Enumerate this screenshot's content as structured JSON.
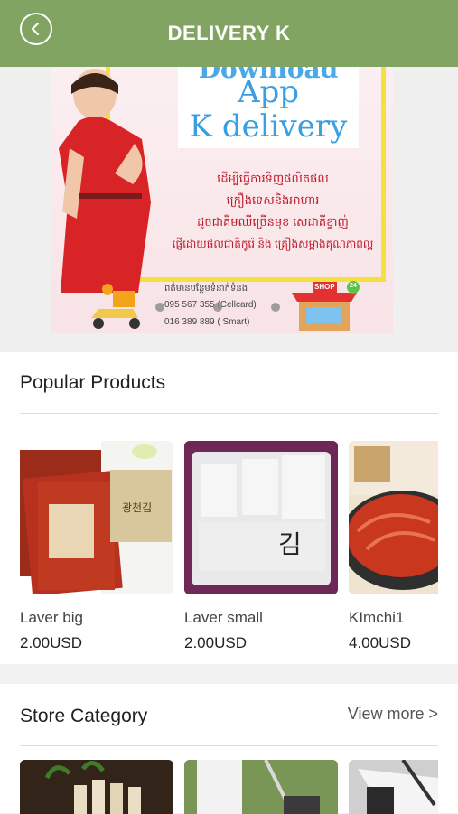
{
  "header": {
    "title": "DELIVERY K",
    "back_icon": "back-arrow-icon"
  },
  "banner": {
    "partial_top": "Download",
    "app_text": "App",
    "brand_text": "K delivery",
    "khmer_lines": [
      "ដើម្បីធ្វើការទិញផលិតផល",
      "ក្រឿងទេសនិងអាហារ",
      "ដូចជាគីមឈីច្រើនមុខ សេដាគីខ្វាញ់",
      "ផ្ញើដោយផលជាតិកូរ៉េ និង គ្រឿងសម្អាងគុណភាពល្អ"
    ],
    "contact_label": "ពត៌មានបន្ថែមទំនាក់ទំនង",
    "phone_1": "095 567 355 (Cellcard)",
    "phone_2": "016 389 889 ( Smart)",
    "shop_sign": "SHOP",
    "shop_badge": "24",
    "active_slide": 1,
    "slide_count": 3
  },
  "popular": {
    "title": "Popular Products",
    "items": [
      {
        "name": "Laver big",
        "price": "2.00USD",
        "box_label": "광천김"
      },
      {
        "name": "Laver small",
        "price": "2.00USD",
        "box_label": "김"
      },
      {
        "name": "KImchi1",
        "price": "4.00USD"
      }
    ]
  },
  "store_category": {
    "title": "Store Category",
    "view_more": "View more >"
  },
  "colors": {
    "appbar": "#82a462",
    "banner_text": "#3a9fe2",
    "khmer_text": "#c0182a"
  }
}
